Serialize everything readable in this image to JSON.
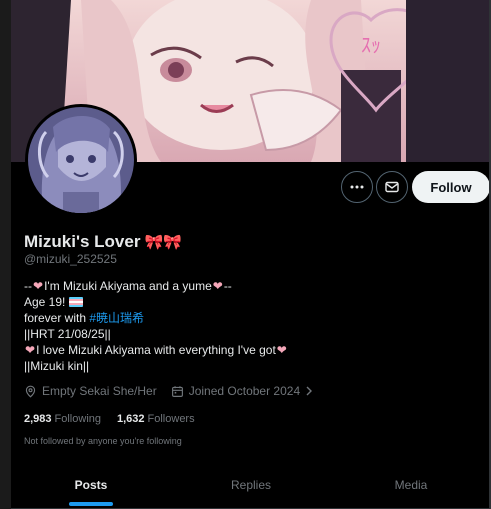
{
  "profile": {
    "display_name": "Mizuki's Lover",
    "name_emoji": "🎀🎀",
    "handle": "@mizuki_252525",
    "bio": {
      "line1_prefix": "--",
      "line1_text": "I'm Mizuki Akiyama and a yume",
      "line1_suffix": "--",
      "line2_text": "Age 19!",
      "line3_prefix": "forever with",
      "line3_hashtag": "#暁山瑞希",
      "line4": "||HRT 21/08/25||",
      "line5_text": "I love Mizuki Akiyama with everything I've got",
      "line6": "||Mizuki kin||"
    },
    "location": "Empty Sekai She/Her",
    "joined": "Joined October 2024",
    "following_count": "2,983",
    "following_label": "Following",
    "followers_count": "1,632",
    "followers_label": "Followers",
    "not_followed_text": "Not followed by anyone you're following"
  },
  "actions": {
    "follow_label": "Follow",
    "more_icon": "ellipsis-icon",
    "message_icon": "mail-icon"
  },
  "tabs": [
    {
      "label": "Posts",
      "active": true
    },
    {
      "label": "Replies",
      "active": false
    },
    {
      "label": "Media",
      "active": false
    }
  ],
  "colors": {
    "accent": "#1d9bf0",
    "heart": "#f4a7b9",
    "muted": "#71767b",
    "follow_bg": "#eff3f4"
  }
}
